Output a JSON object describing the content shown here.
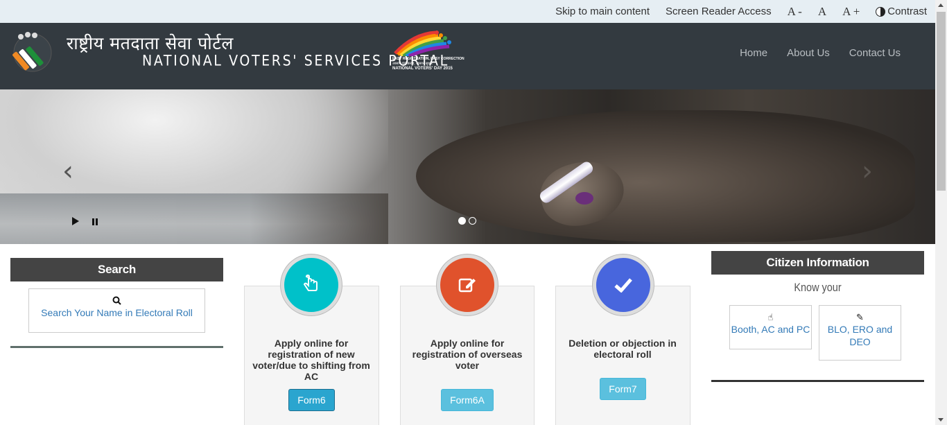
{
  "topbar": {
    "skip": "Skip to main content",
    "screen_reader": "Screen Reader Access",
    "font_decrease": "A -",
    "font_normal": "A",
    "font_increase": "A +",
    "contrast": "Contrast"
  },
  "header": {
    "hindi_title": "राष्ट्रीय मतदाता सेवा पोर्टल",
    "english_title": "NATIONAL VOTERS' SERVICES PORTAL",
    "nvd_line1": "EASY REGISTRATION, EASY CORRECTION",
    "nvd_line2": "आसान पंजीकरण, आसान सुधार",
    "nvd_line3": "NATIONAL VOTERS' DAY 2015",
    "nav": [
      "Home",
      "About Us",
      "Contact Us"
    ]
  },
  "slider": {
    "prev_icon": "‹",
    "next_icon": "›",
    "active_slide": 1,
    "slide_count": 2
  },
  "search": {
    "title": "Search",
    "link": "Search Your Name in Electoral Roll"
  },
  "cards": [
    {
      "text": "Apply online for registration of new voter/due to shifting from AC",
      "button": "Form6",
      "color": "#00b5bf",
      "icon": "hand-pointer-icon"
    },
    {
      "text": "Apply online for registration of overseas voter",
      "button": "Form6A",
      "color": "#d94f2b",
      "icon": "edit-icon"
    },
    {
      "text": "Deletion or objection in electoral roll",
      "button": "Form7",
      "color": "#4765d8",
      "icon": "check-icon"
    }
  ],
  "citizen": {
    "title": "Citizen Information",
    "subtitle": "Know your",
    "links": [
      "Booth, AC and PC",
      "BLO, ERO and DEO"
    ]
  },
  "colors": {
    "header_bg": "#333a40",
    "panel_title_bg": "#444444",
    "button_blue": "#5bc0de",
    "link_blue": "#337ab7"
  }
}
